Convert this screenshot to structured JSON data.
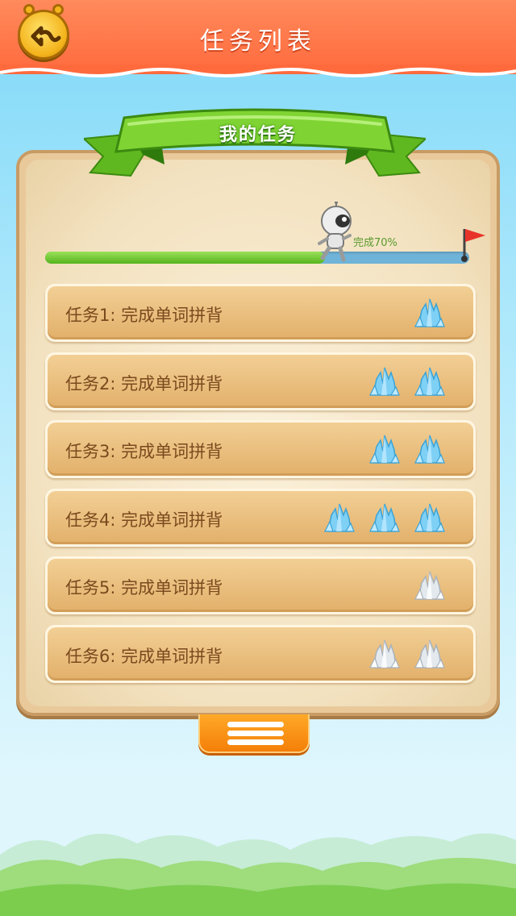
{
  "header": {
    "title": "任务列表"
  },
  "panel": {
    "ribbon_title": "我的任务"
  },
  "progress": {
    "label": "完成70%",
    "fraction": 0.66
  },
  "tasks": [
    {
      "label": "任务1:  完成单词拼背",
      "gems": 1,
      "gem_state": "blue"
    },
    {
      "label": "任务2:  完成单词拼背",
      "gems": 2,
      "gem_state": "blue"
    },
    {
      "label": "任务3:  完成单词拼背",
      "gems": 2,
      "gem_state": "blue"
    },
    {
      "label": "任务4:  完成单词拼背",
      "gems": 3,
      "gem_state": "blue"
    },
    {
      "label": "任务5:  完成单词拼背",
      "gems": 1,
      "gem_state": "white"
    },
    {
      "label": "任务6:  完成单词拼背",
      "gems": 2,
      "gem_state": "white"
    }
  ],
  "icons": {
    "back": "back-arrow-icon",
    "gem": "crystal-gem-icon",
    "menu": "menu-icon",
    "flag": "goal-flag-icon",
    "robot": "robot-avatar-icon"
  },
  "colors": {
    "header": "#ff6a3d",
    "ribbon": "#6cc62a",
    "progress_fill": "#55b41c",
    "progress_track": "#6fb3d8",
    "task_text": "#7a4a1e",
    "menu_tab": "#f47f08"
  }
}
